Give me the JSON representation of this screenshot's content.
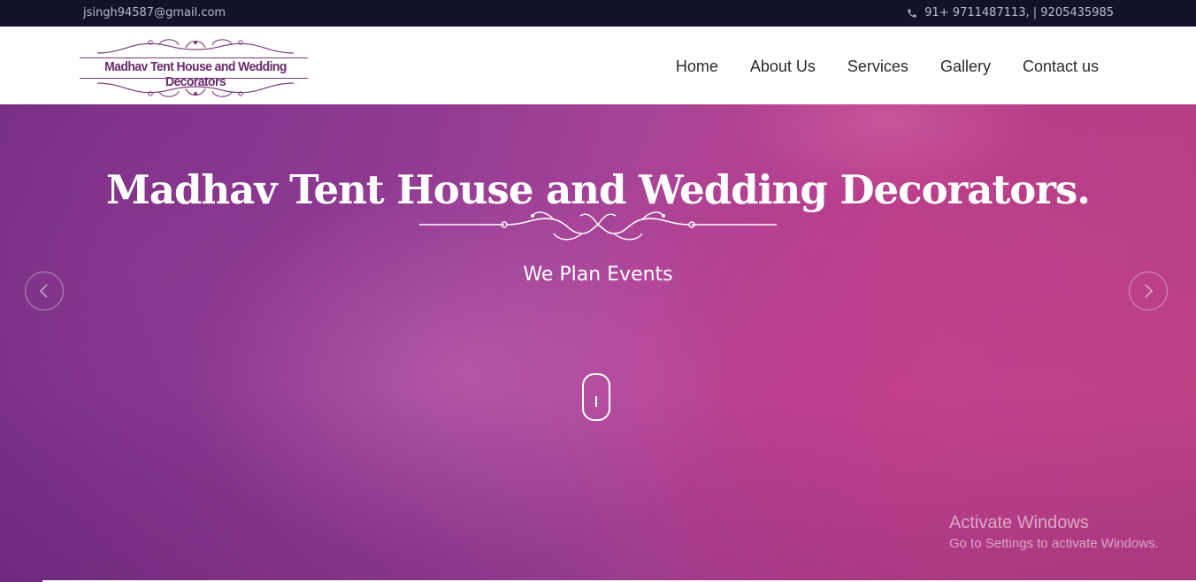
{
  "topbar": {
    "email": "jsingh94587@gmail.com",
    "phone_icon": "phone-icon",
    "phone": "91+ 9711487113, | 9205435985"
  },
  "logo": {
    "text": "Madhav Tent House and Wedding Decorators"
  },
  "nav": {
    "items": [
      {
        "label": "Home"
      },
      {
        "label": "About Us"
      },
      {
        "label": "Services"
      },
      {
        "label": "Gallery"
      },
      {
        "label": "Contact us"
      }
    ]
  },
  "hero": {
    "title": "Madhav Tent House and Wedding Decorators.",
    "subtitle": "We Plan Events",
    "prev_icon": "chevron-left-icon",
    "next_icon": "chevron-right-icon",
    "scroll_icon": "mouse-scroll-icon"
  },
  "watermark": {
    "title": "Activate Windows",
    "subtitle": "Go to Settings to activate Windows."
  },
  "colors": {
    "topbar_bg": "#10132a",
    "logo_purple": "#6a2a6e",
    "hero_left": "#7b3288",
    "hero_right": "#c44488"
  }
}
